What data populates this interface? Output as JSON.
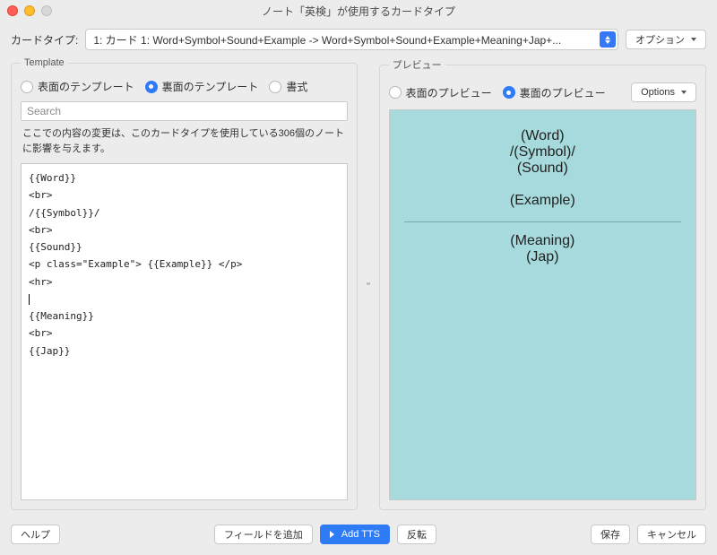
{
  "window": {
    "title": "ノート「英検」が使用するカードタイプ"
  },
  "topbar": {
    "card_type_label": "カードタイプ:",
    "dropdown_value": "1: カード 1: Word+Symbol+Sound+Example -> Word+Symbol+Sound+Example+Meaning+Jap+...",
    "options_button": "オプション"
  },
  "template_panel": {
    "legend": "Template",
    "radio_front": "表面のテンプレート",
    "radio_back": "裏面のテンプレート",
    "radio_style": "書式",
    "search_placeholder": "Search",
    "note": "ここでの内容の変更は、このカードタイプを使用している306個のノートに影響を与えます。",
    "code": "{{Word}}\n<br>\n/{{Symbol}}/\n<br>\n{{Sound}}\n<p class=\"Example\"> {{Example}} </p>\n<hr>\n\n{{Meaning}}\n<br>\n{{Jap}}"
  },
  "preview_panel": {
    "legend": "プレビュー",
    "radio_front": "表面のプレビュー",
    "radio_back": "裏面のプレビュー",
    "options_button": "Options",
    "lines": {
      "word": "(Word)",
      "symbol": "/(Symbol)/",
      "sound": "(Sound)",
      "example": "(Example)",
      "meaning": "(Meaning)",
      "jap": "(Jap)"
    }
  },
  "bottom": {
    "help": "ヘルプ",
    "add_field": "フィールドを追加",
    "add_tts": "Add TTS",
    "flip": "反転",
    "save": "保存",
    "cancel": "キャンセル"
  }
}
